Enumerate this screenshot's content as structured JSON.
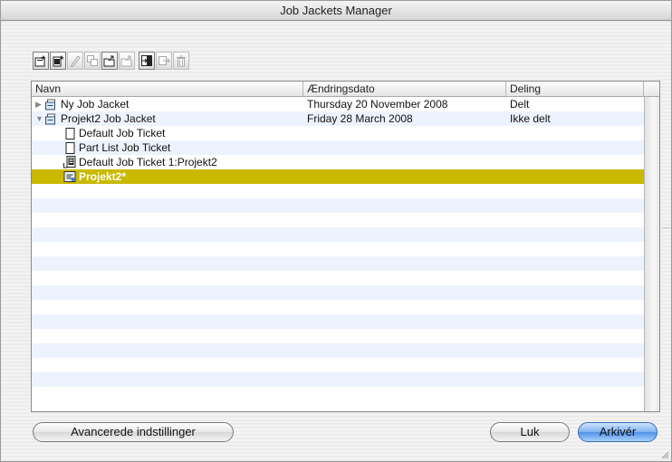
{
  "window": {
    "title": "Job Jackets Manager"
  },
  "toolbar": {
    "buttons": [
      {
        "name": "new-job-jacket",
        "enabled": true
      },
      {
        "name": "new-job-ticket",
        "enabled": true
      },
      {
        "name": "edit",
        "enabled": false
      },
      {
        "name": "duplicate",
        "enabled": false
      },
      {
        "name": "open-folder",
        "enabled": true
      },
      {
        "name": "open-folder-2",
        "enabled": false
      },
      {
        "name": "import",
        "enabled": true
      },
      {
        "name": "export",
        "enabled": false
      },
      {
        "name": "delete",
        "enabled": false
      }
    ]
  },
  "columns": {
    "name": "Navn",
    "date": "Ændringsdato",
    "sharing": "Deling"
  },
  "rows": [
    {
      "indent": 0,
      "disclosure": "▶",
      "icon": "jacket-icon",
      "name": "Ny Job Jacket",
      "date": "Thursday 20 November 2008",
      "sharing": "Delt"
    },
    {
      "indent": 0,
      "disclosure": "▼",
      "icon": "jacket-icon",
      "name": "Projekt2 Job Jacket",
      "date": "Friday 28 March 2008",
      "sharing": "Ikke delt"
    },
    {
      "indent": 1,
      "disclosure": "",
      "icon": "ticket-icon",
      "name": "Default Job Ticket",
      "date": "",
      "sharing": ""
    },
    {
      "indent": 1,
      "disclosure": "",
      "icon": "ticket-icon",
      "name": "Part List Job Ticket",
      "date": "",
      "sharing": ""
    },
    {
      "indent": 1,
      "disclosure": "",
      "icon": "project-ticket-icon",
      "name": "Default Job Ticket 1:Projekt2",
      "date": "",
      "sharing": ""
    },
    {
      "indent": 1,
      "disclosure": "",
      "icon": "project-icon",
      "name": "Projekt2*",
      "date": "",
      "sharing": "",
      "selected": true
    }
  ],
  "buttons": {
    "advanced": "Avancerede indstillinger",
    "close": "Luk",
    "archive": "Arkivér"
  },
  "colors": {
    "selection": "#c9b901",
    "stripe": "#edf3fe",
    "default_button": "#4f92e6"
  }
}
